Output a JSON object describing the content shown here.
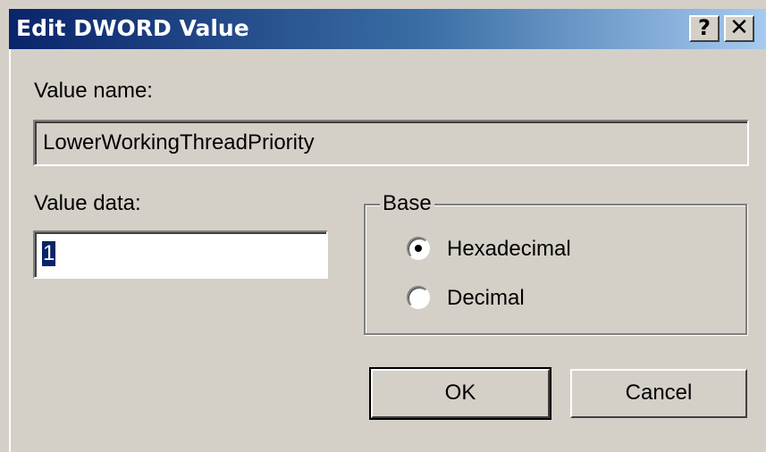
{
  "titlebar": {
    "title": "Edit DWORD Value",
    "help_label": "?",
    "close_label": "✕"
  },
  "value_name": {
    "label": "Value name:",
    "value": "LowerWorkingThreadPriority"
  },
  "value_data": {
    "label": "Value data:",
    "value": "1"
  },
  "base": {
    "label": "Base",
    "options": [
      {
        "label": "Hexadecimal",
        "selected": true
      },
      {
        "label": "Decimal",
        "selected": false
      }
    ]
  },
  "buttons": {
    "ok_label": "OK",
    "cancel_label": "Cancel"
  }
}
